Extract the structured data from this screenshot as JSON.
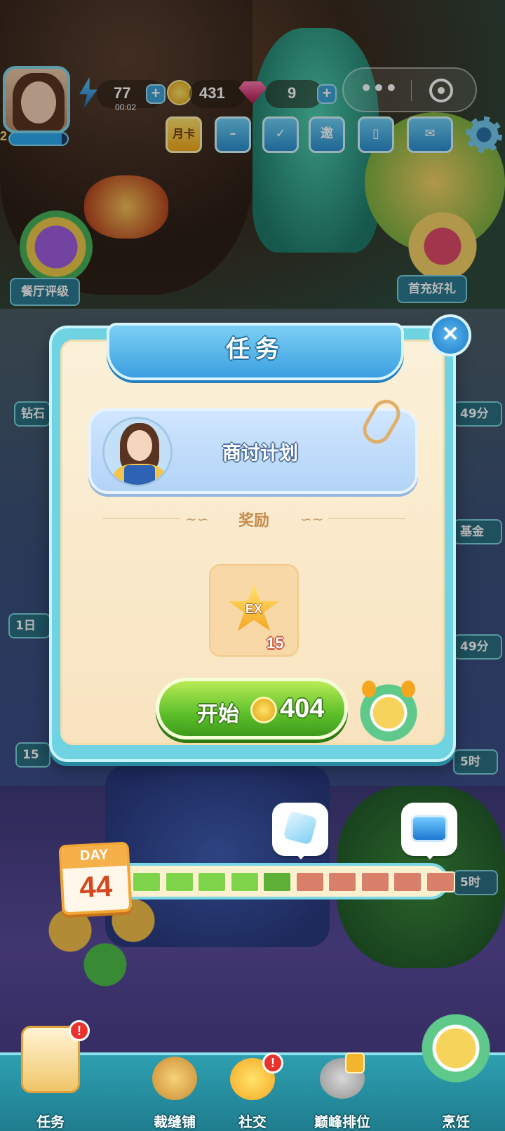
{
  "hud": {
    "energy": "77",
    "energy_timer": "00:02",
    "coins": "431",
    "gems": "9",
    "level": "2",
    "level_progress": 0.9,
    "month_card_label": "月卡",
    "invite_label": "邀"
  },
  "side": {
    "restaurant_rating": "餐厅评级",
    "first_recharge": "首充好礼",
    "left_chip_1": "钻石",
    "left_chip_2": "1日",
    "left_chip_3": "15",
    "right_chip_1": "49分",
    "right_chip_2": "基金",
    "right_chip_3": "49分",
    "right_chip_4": "5时",
    "right_chip_5": "5时"
  },
  "dialog": {
    "title": "任务",
    "task_name": "商讨计划",
    "reward_title": "奖励",
    "reward_item": "EX",
    "reward_count": "15",
    "start_label": "开始",
    "start_cost": "404"
  },
  "day": {
    "label": "DAY",
    "number": "44",
    "segments_total": 10,
    "segments_done": 5
  },
  "nav": {
    "items": [
      {
        "label": "任务",
        "badge": "!"
      },
      {
        "label": "裁缝铺"
      },
      {
        "label": "社交",
        "badge": "!"
      },
      {
        "label": "巅峰排位"
      },
      {
        "label": "烹饪"
      }
    ]
  },
  "colors": {
    "accent": "#3b9fe0",
    "primary_button": "#5cbf2a",
    "progress_done": "#7dd34a",
    "progress_todo": "#d9806a",
    "badge": "#e9322d"
  }
}
